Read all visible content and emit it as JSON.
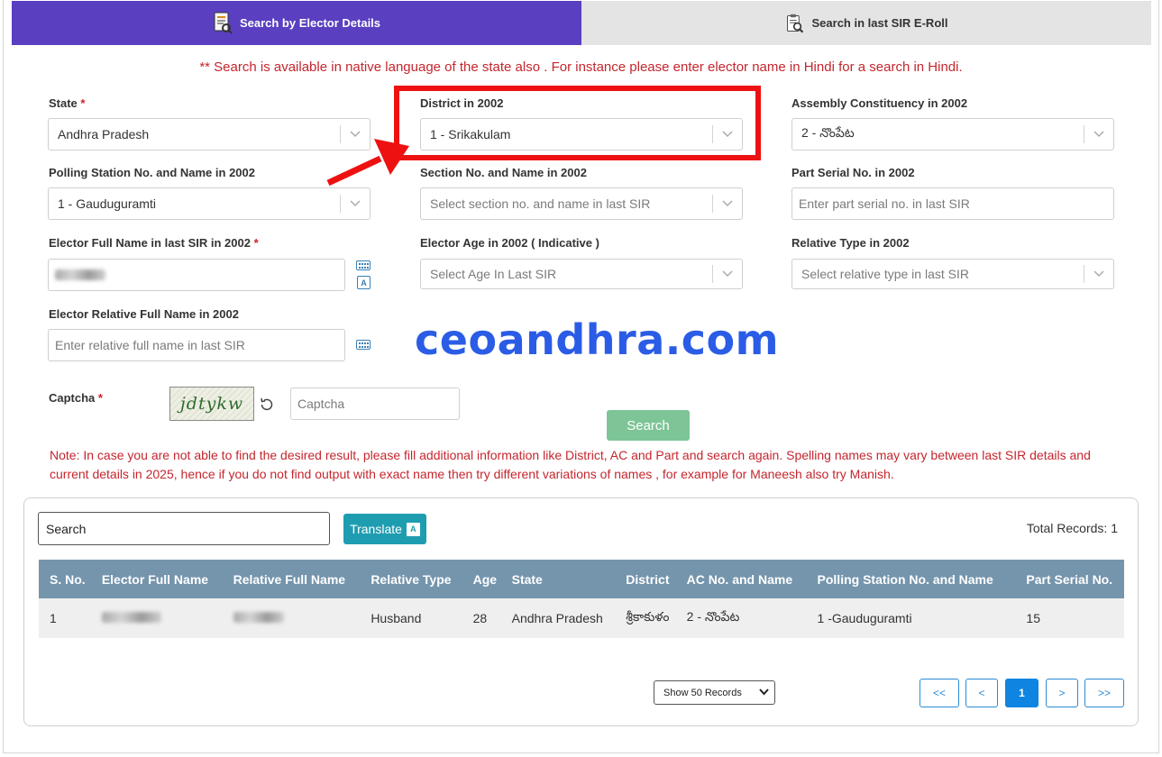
{
  "tabs": [
    {
      "label": "Search by Elector Details",
      "icon": "document-search-icon",
      "active": true
    },
    {
      "label": "Search in last SIR E-Roll",
      "icon": "clipboard-search-icon",
      "active": false
    }
  ],
  "notice": "** Search is available in native language of the state also . For instance please enter elector name in Hindi for a search in Hindi.",
  "form": {
    "state": {
      "label": "State",
      "required": "*",
      "value": "Andhra Pradesh"
    },
    "district": {
      "label": "District in 2002",
      "value": "1 - Srikakulam"
    },
    "assembly": {
      "label": "Assembly Constituency in 2002",
      "value": "2 - నొంపేట"
    },
    "polling_station": {
      "label": "Polling Station No. and Name in 2002",
      "value": "1 - Gauduguramti"
    },
    "section": {
      "label": "Section No. and Name in 2002",
      "placeholder": "Select section no. and name in last SIR"
    },
    "part_serial": {
      "label": "Part Serial No. in 2002",
      "placeholder": "Enter part serial no. in last SIR"
    },
    "elector_name": {
      "label": "Elector Full Name in last SIR in 2002",
      "required": "*"
    },
    "elector_age": {
      "label": "Elector Age in 2002 ( Indicative )",
      "placeholder": "Select Age In Last SIR"
    },
    "relative_type": {
      "label": "Relative Type in 2002",
      "placeholder": "Select relative type in last SIR"
    },
    "relative_name": {
      "label": "Elector Relative Full Name in 2002",
      "placeholder": "Enter relative full name in last SIR"
    },
    "captcha": {
      "label": "Captcha",
      "required": "*",
      "image_text": "jdtykw",
      "placeholder": "Captcha"
    },
    "search_label": "Search"
  },
  "watermark": "ceoandhra.com",
  "note": "Note: In case you are not able to find the desired result, please fill additional information like District, AC and Part and search again. Spelling names may vary between last SIR details and current details in 2025, hence if you do not find output with exact name then try different variations of names , for example for Maneesh also try Manish.",
  "results": {
    "search_value": "Search",
    "translate_label": "Translate",
    "translate_icon": "translate-icon",
    "total_records": "Total Records: 1",
    "columns": [
      "S. No.",
      "Elector Full Name",
      "Relative Full Name",
      "Relative Type",
      "Age",
      "State",
      "District",
      "AC No. and Name",
      "Polling Station No. and Name",
      "Part Serial No."
    ],
    "rows": [
      {
        "sno": "1",
        "relative_type": "Husband",
        "age": "28",
        "state": "Andhra Pradesh",
        "district": "శ్రీకాకుళం",
        "ac": "2 - నొంపేట",
        "polling_station": "1 -Gauduguramti",
        "part_serial": "15"
      }
    ],
    "page_size": "Show 50 Records",
    "pagination": [
      "<<",
      "<",
      "1",
      ">",
      ">>"
    ]
  },
  "colors": {
    "active_tab": "#5a3fc0",
    "notice_red": "#c4262e",
    "search_green": "#7dc596",
    "translate_teal": "#1f9db0",
    "table_header": "#7595ad",
    "page_active": "#0f84e0",
    "annotation_red": "#ee1111"
  }
}
